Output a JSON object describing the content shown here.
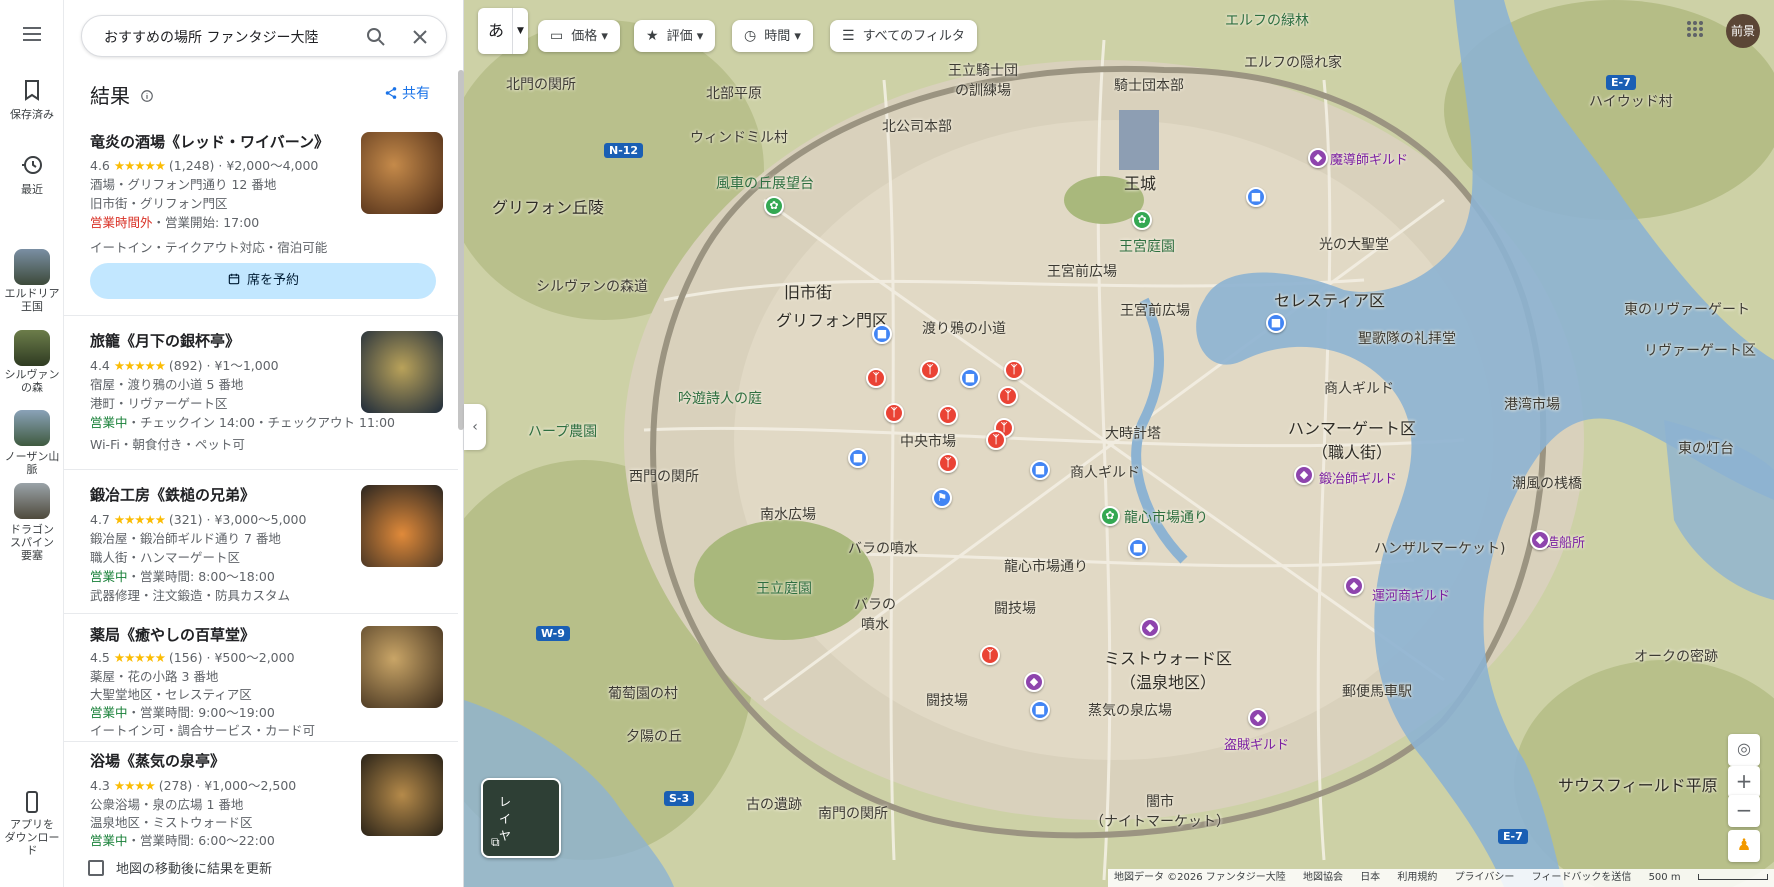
{
  "rail": {
    "saved": "保存済み",
    "recent": "最近",
    "places": [
      "エルドリア\n王国",
      "シルヴァン\nの森",
      "ノーザン山脈",
      "ドラゴン\nスパイン\n要塞"
    ],
    "app": "アプリを\nダウンロード"
  },
  "search": {
    "query": "おすすめの場所 ファンタジー大陸"
  },
  "results": {
    "title": "結果",
    "share": "共有",
    "reserve": "席を予約",
    "update_checkbox": "地図の移動後に結果を更新",
    "items": [
      {
        "name": "竜炎の酒場《レッド・ワイバーン》",
        "rating": "4.6",
        "stars": "★★★★★",
        "reviews": "(1,248)",
        "price": "¥2,000～4,000",
        "category": "酒場・グリフォン門通り 12 番地",
        "district": "旧市街・グリフォン門区",
        "status": "営業時間外",
        "status_detail": "・営業開始: 17:00",
        "extra": "イートイン・テイクアウト対応・宿泊可能"
      },
      {
        "name": "旅籠《月下の銀杯亭》",
        "rating": "4.4",
        "stars": "★★★★★",
        "reviews": "(892)",
        "price": "¥1～1,000",
        "category": "宿屋・渡り鴉の小道 5 番地",
        "district": "港町・リヴァーゲート区",
        "status": "営業中",
        "status_detail": "・チェックイン 14:00・チェックアウト 11:00",
        "extra": "Wi-Fi・朝食付き・ペット可"
      },
      {
        "name": "鍛冶工房《鉄槌の兄弟》",
        "rating": "4.7",
        "stars": "★★★★★",
        "reviews": "(321)",
        "price": "¥3,000～5,000",
        "category": "鍛冶屋・鍛冶師ギルド通り 7 番地",
        "district": "職人街・ハンマーゲート区",
        "status": "営業中",
        "status_detail": "・営業時間: 8:00～18:00",
        "extra": "武器修理・注文鍛造・防具カスタム"
      },
      {
        "name": "薬局《癒やしの百草堂》",
        "rating": "4.5",
        "stars": "★★★★★",
        "reviews": "(156)",
        "price": "¥500～2,000",
        "category": "薬屋・花の小路 3 番地",
        "district": "大聖堂地区・セレスティア区",
        "status": "営業中",
        "status_detail": "・営業時間: 9:00～19:00",
        "extra": "イートイン可・調合サービス・カード可"
      },
      {
        "name": "浴場《蒸気の泉亭》",
        "rating": "4.3",
        "stars": "★★★★",
        "reviews": "(278)",
        "price": "¥1,000～2,500",
        "category": "公衆浴場・泉の広場 1 番地",
        "district": "温泉地区・ミストウォード区",
        "status": "営業中",
        "status_detail": "・営業時間: 6:00～22:00",
        "extra": ""
      }
    ]
  },
  "chips": {
    "ime": "あ",
    "price": "価格",
    "rating": "評価",
    "hours": "時間",
    "all_filters": "すべてのフィルタ"
  },
  "account": {
    "avatar": "前景"
  },
  "layers": {
    "label": "レイヤ"
  },
  "map_labels": {
    "elf_forest": "エルフの緑林",
    "elf_hidden": "エルフの隠れ家",
    "hayward": "ハイウッド村",
    "north_gate": "北門の関所",
    "north_plain": "北部平原",
    "knights_training": "王立騎士団\nの訓練場",
    "knights_hq": "騎士団本部",
    "north_hq": "北公司本部",
    "windmill": "ウィンドミル村",
    "mage_guild": "魔導師ギルド",
    "windmill_hill": "風車の丘展望台",
    "castle": "王城",
    "griffon_hill": "グリフォン丘陵",
    "royal_garden": "王宮庭園",
    "great_cathedral": "光の大聖堂",
    "royal_plaza": "王宮前広場",
    "royal_plaza2": "王宮前広場",
    "old_town": "旧市街",
    "celestia": "セレスティア区",
    "east_rivergate": "東のリヴァーゲート",
    "sylvan_road": "シルヴァンの森道",
    "griffon_gate": "グリフォン門区",
    "crow_alley": "渡り鴉の小道",
    "holy_chapel": "聖歌隊の礼拝堂",
    "rivergate": "リヴァーゲート区",
    "merchant_guild": "商人ギルド",
    "port_market": "港湾市場",
    "bard_garden": "吟遊詩人の庭",
    "harp_farm": "ハープ農園",
    "grand_clock": "大時計塔",
    "hammergate": "ハンマーゲート区\n（職人街）",
    "central_market": "中央市場",
    "east_lighthouse": "東の灯台",
    "west_gate": "西門の関所",
    "trade_guild": "商人ギルド",
    "smith_guild": "鍛冶師ギルド",
    "tide_tower": "潮風の桟橋",
    "south_square": "南水広場",
    "dragon_street": "龍心市場通り",
    "shipyard": "造船所",
    "rose_fountain": "バラの噴水",
    "hanseatic": "ハンザルマーケット)",
    "dragon_market": "龍心市場通り",
    "royal_court": "王立庭園",
    "rose_fountain2": "バラの\n噴水",
    "canal_guild": "運河商ギルド",
    "arena": "闘技場",
    "mistward": "ミストウォード区\n（温泉地区）",
    "oak_forest": "オークの密跡",
    "vineyard": "葡萄園の村",
    "arena2": "闘技場",
    "post_office": "郵便馬車駅",
    "steam_square": "蒸気の泉広場",
    "sunset_hill": "夕陽の丘",
    "thief_guild": "盗賊ギルド",
    "ancient_ruins": "古の遺跡",
    "south_gate": "南門の関所",
    "night_market": "闇市\n（ナイトマーケット）",
    "southfield": "サウスフィールド平原"
  },
  "road_shields": [
    "N-12",
    "E-7",
    "W-9",
    "S-3",
    "E-7"
  ],
  "attribution": {
    "data": "地図データ ©2026 ファンタジー大陸",
    "assoc": "地図協会",
    "country": "日本",
    "terms": "利用規約",
    "privacy": "プライバシー",
    "feedback": "フィードバックを送信",
    "scale": "500 m"
  },
  "colors": {
    "accent": "#1a73e8",
    "open": "#188038",
    "closed": "#d93025",
    "star": "#fbbc04",
    "water": "#6f9fc4",
    "land": "#d6cfb8",
    "forest": "#a8b57c",
    "city": "#cfc6b0"
  }
}
